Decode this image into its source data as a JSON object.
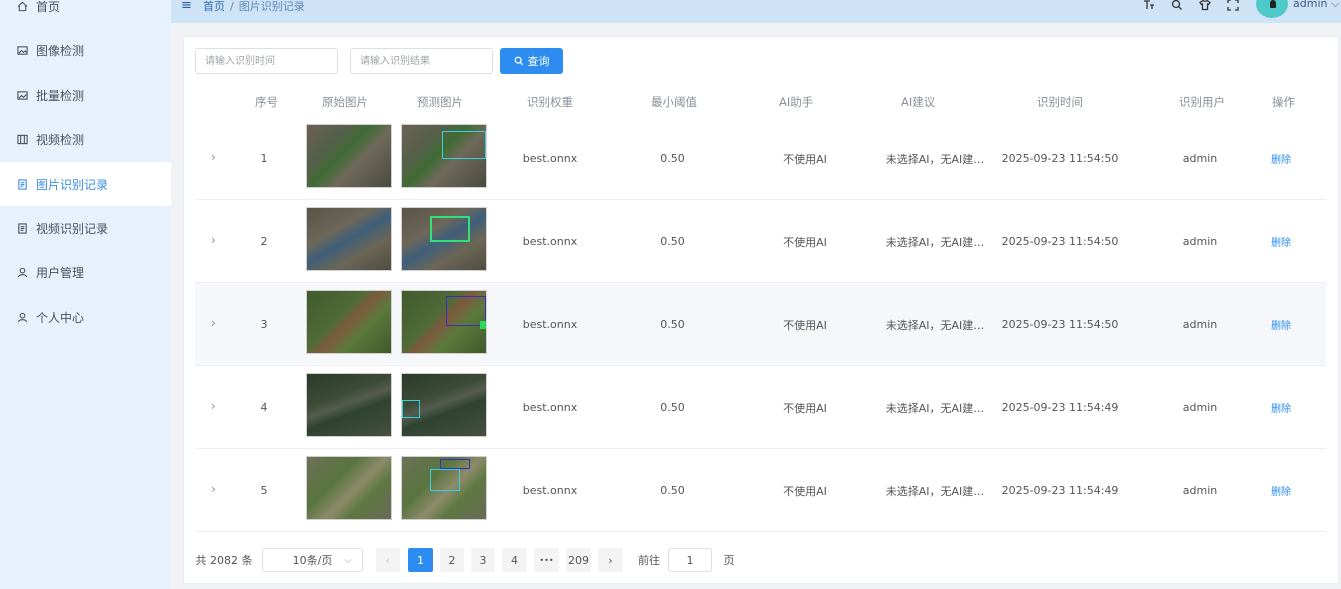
{
  "sidebar": {
    "items": [
      {
        "label": "首页",
        "icon": "home-icon"
      },
      {
        "label": "图像检测",
        "icon": "image-icon"
      },
      {
        "label": "批量检测",
        "icon": "images-icon"
      },
      {
        "label": "视频检测",
        "icon": "video-icon"
      },
      {
        "label": "图片识别记录",
        "icon": "document-icon",
        "active": true
      },
      {
        "label": "视频识别记录",
        "icon": "document-icon"
      },
      {
        "label": "用户管理",
        "icon": "user-icon"
      },
      {
        "label": "个人中心",
        "icon": "user-icon"
      }
    ]
  },
  "header": {
    "breadcrumb": [
      "首页",
      "图片识别记录"
    ],
    "breadcrumb_sep": "/",
    "user": "admin"
  },
  "search": {
    "time_placeholder": "请输入识别时间",
    "result_placeholder": "请输入识别结果",
    "query_label": "查询"
  },
  "table": {
    "columns": [
      "序号",
      "原始图片",
      "预测图片",
      "识别权重",
      "最小阈值",
      "AI助手",
      "AI建议",
      "识别时间",
      "识别用户",
      "操作"
    ],
    "rows": [
      {
        "index": "1",
        "weight": "best.onnx",
        "threshold": "0.50",
        "ai": "不使用AI",
        "advice": "未选择AI，无AI建…",
        "time": "2025-09-23 11:54:50",
        "user": "admin",
        "action": "删除"
      },
      {
        "index": "2",
        "weight": "best.onnx",
        "threshold": "0.50",
        "ai": "不使用AI",
        "advice": "未选择AI，无AI建…",
        "time": "2025-09-23 11:54:50",
        "user": "admin",
        "action": "删除"
      },
      {
        "index": "3",
        "weight": "best.onnx",
        "threshold": "0.50",
        "ai": "不使用AI",
        "advice": "未选择AI，无AI建…",
        "time": "2025-09-23 11:54:50",
        "user": "admin",
        "action": "删除"
      },
      {
        "index": "4",
        "weight": "best.onnx",
        "threshold": "0.50",
        "ai": "不使用AI",
        "advice": "未选择AI，无AI建…",
        "time": "2025-09-23 11:54:49",
        "user": "admin",
        "action": "删除"
      },
      {
        "index": "5",
        "weight": "best.onnx",
        "threshold": "0.50",
        "ai": "不使用AI",
        "advice": "未选择AI，无AI建…",
        "time": "2025-09-23 11:54:49",
        "user": "admin",
        "action": "删除"
      }
    ]
  },
  "pagination": {
    "total": "共 2082 条",
    "page_size": "10条/页",
    "pages": [
      "1",
      "2",
      "3",
      "4"
    ],
    "ellipsis": "•••",
    "last_page": "209",
    "goto_label": "前往",
    "goto_value": "1",
    "page_suffix": "页"
  },
  "colors": {
    "accent": "#2d8cf0",
    "sidebar_bg": "#e6f1fc",
    "header_bg": "#cfe3f7"
  }
}
